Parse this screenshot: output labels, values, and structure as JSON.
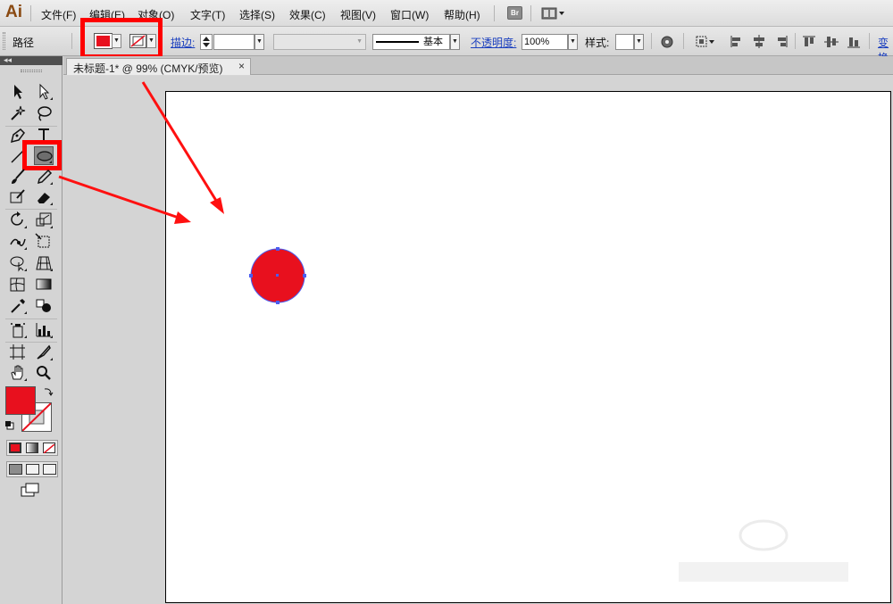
{
  "app": {
    "logo": "Ai"
  },
  "menu": [
    {
      "label": "文件(F)"
    },
    {
      "label": "编辑(E)"
    },
    {
      "label": "对象(O)"
    },
    {
      "label": "文字(T)"
    },
    {
      "label": "选择(S)"
    },
    {
      "label": "效果(C)"
    },
    {
      "label": "视图(V)"
    },
    {
      "label": "窗口(W)"
    },
    {
      "label": "帮助(H)"
    }
  ],
  "menubar": {
    "bridge_label": "Br"
  },
  "control": {
    "selection_type": "路径",
    "fill_color": "#e8101e",
    "stroke_label": "描边:",
    "stroke_style": "基本",
    "opacity_label": "不透明度:",
    "opacity_value": "100%",
    "style_label": "样式:",
    "transform_label": "变换"
  },
  "document": {
    "tab_title": "未标题-1* @ 99% (CMYK/预览)",
    "close_glyph": "×"
  },
  "canvas": {
    "artboard_color": "#ffffff",
    "shape": {
      "type": "ellipse",
      "fill": "#e8101e",
      "selection_color": "#4a5cf0"
    }
  },
  "toolbox": {
    "fill_color": "#e8101e",
    "stroke": "none",
    "active_tool": "ellipse-tool"
  },
  "annotations": {
    "highlight_color": "#ff0000"
  }
}
